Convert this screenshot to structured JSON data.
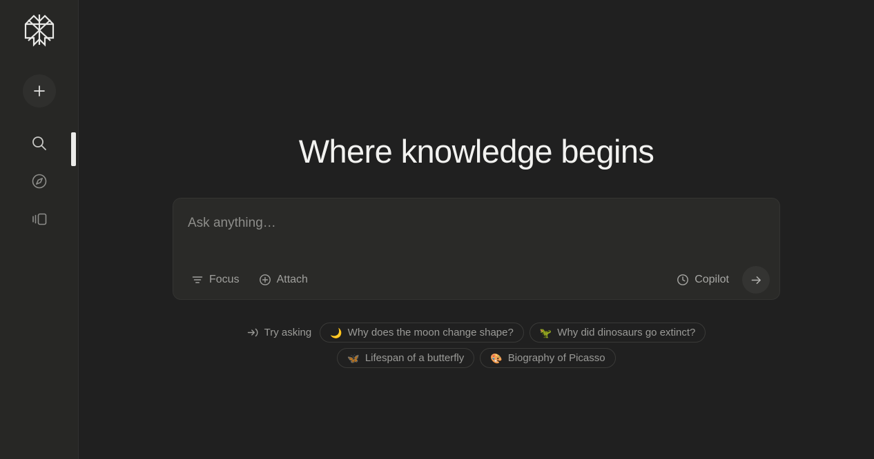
{
  "colors": {
    "app_background": "#202020",
    "sidebar_background": "#272725",
    "search_box_background": "#2a2a28",
    "border": "#343432",
    "text_primary": "#f2f2f0",
    "text_muted": "#9b9b98",
    "scrollbar_thumb": "#ececea"
  },
  "sidebar": {
    "logo": {
      "name": "perplexity-logo"
    },
    "new_thread": {
      "icon": "plus-icon",
      "label": "New Thread"
    },
    "items": [
      {
        "icon": "search-icon",
        "label": "Search"
      },
      {
        "icon": "compass-icon",
        "label": "Discover"
      },
      {
        "icon": "library-icon",
        "label": "Library"
      }
    ]
  },
  "main": {
    "title": "Where knowledge begins",
    "search": {
      "placeholder": "Ask anything…",
      "value": "",
      "focus_label": "Focus",
      "focus_icon": "filter-icon",
      "attach_label": "Attach",
      "attach_icon": "plus-circle-icon",
      "copilot_label": "Copilot",
      "copilot_icon": "clock-icon",
      "submit_icon": "arrow-right-icon"
    },
    "suggestions": {
      "prompt_label": "Try asking",
      "prompt_icon": "arrow-right-to-bracket-icon",
      "row1": [
        {
          "emoji": "🌙",
          "emoji_name": "crescent-moon-emoji",
          "label": "Why does the moon change shape?"
        },
        {
          "emoji": "🦖",
          "emoji_name": "t-rex-emoji",
          "label": "Why did dinosaurs go extinct?"
        }
      ],
      "row2": [
        {
          "emoji": "🦋",
          "emoji_name": "butterfly-emoji",
          "label": "Lifespan of a butterfly"
        },
        {
          "emoji": "🎨",
          "emoji_name": "artist-palette-emoji",
          "label": "Biography of Picasso"
        }
      ]
    }
  }
}
